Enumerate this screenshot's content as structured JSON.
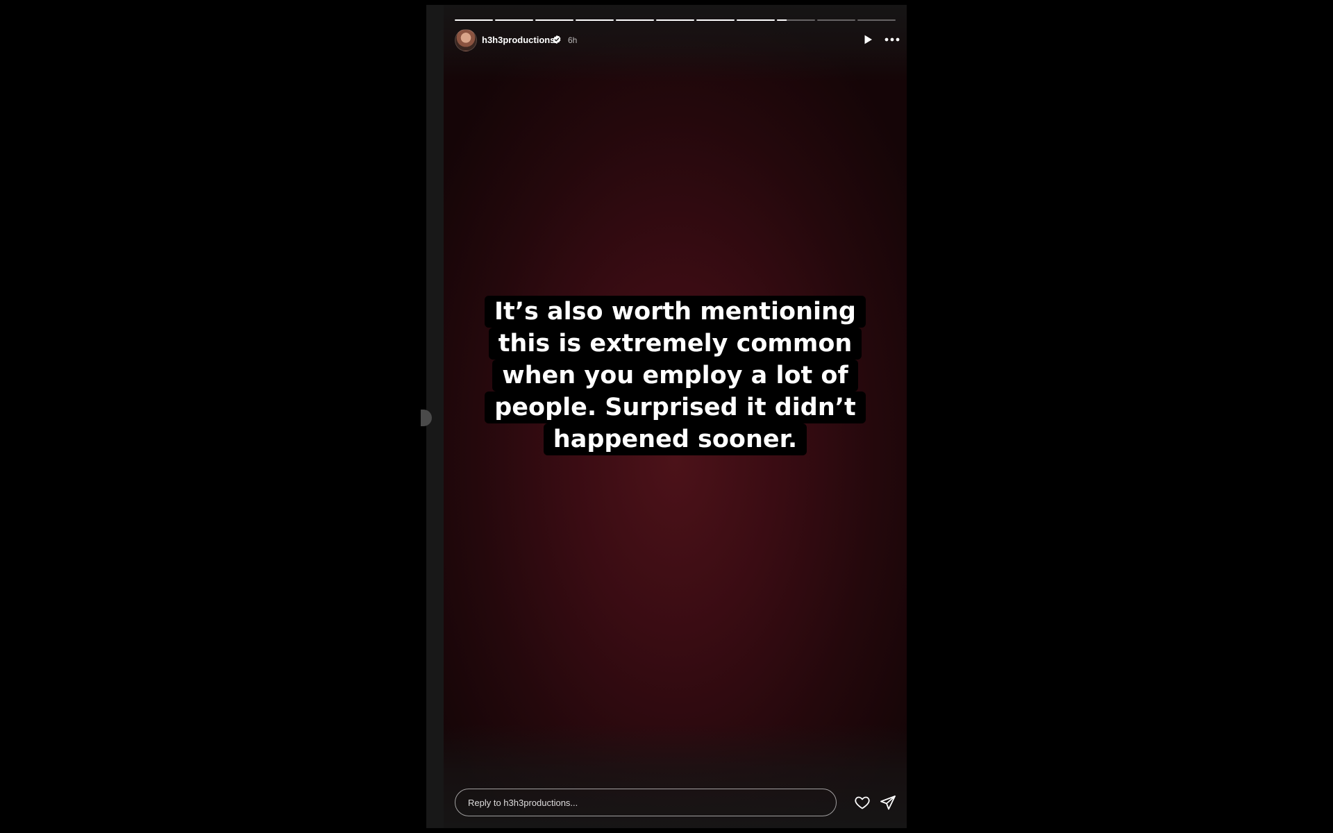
{
  "story": {
    "username": "h3h3productions",
    "time": "6h",
    "verified": true,
    "segments": [
      1,
      1,
      1,
      1,
      1,
      1,
      1,
      1,
      0.25,
      0,
      0
    ],
    "caption_lines": [
      "It’s also worth mentioning",
      "this is extremely common",
      "when you employ a lot of",
      "people. Surprised it didn’t",
      "happened sooner."
    ],
    "background_color": "#3a0c13"
  },
  "icons": {
    "play": "play-icon",
    "more": "more-options-icon",
    "heart": "heart-icon",
    "send": "send-icon",
    "verified": "verified-badge-icon"
  },
  "footer": {
    "reply_placeholder": "Reply to h3h3productions..."
  }
}
